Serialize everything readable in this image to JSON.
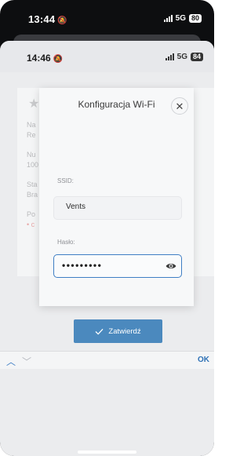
{
  "outer_status": {
    "time": "13:44",
    "network": "5G",
    "battery": "80"
  },
  "inner_status": {
    "time": "14:46",
    "network": "5G",
    "battery": "84"
  },
  "background_card": {
    "lines": [
      "Na",
      "Re",
      "Nu",
      "100",
      "Sta",
      "Bra",
      "Po",
      "• c"
    ]
  },
  "dialog": {
    "title": "Konfiguracja Wi-Fi",
    "ssid_label": "SSID:",
    "ssid_value": "Vents",
    "password_label": "Hasło:",
    "password_value": "•••••••••",
    "submit_label": "Zatwierdź"
  },
  "accessory_bar": {
    "done_label": "OK"
  },
  "icons": {
    "silent": "bell-slash-icon",
    "close": "close-icon",
    "eye": "eye-icon",
    "check": "check-icon",
    "up": "chevron-up-icon",
    "down": "chevron-down-icon",
    "star": "star-icon"
  },
  "colors": {
    "accent": "#4b89be",
    "ok_text": "#2f72b6",
    "focus_border": "#3f7ec4"
  }
}
